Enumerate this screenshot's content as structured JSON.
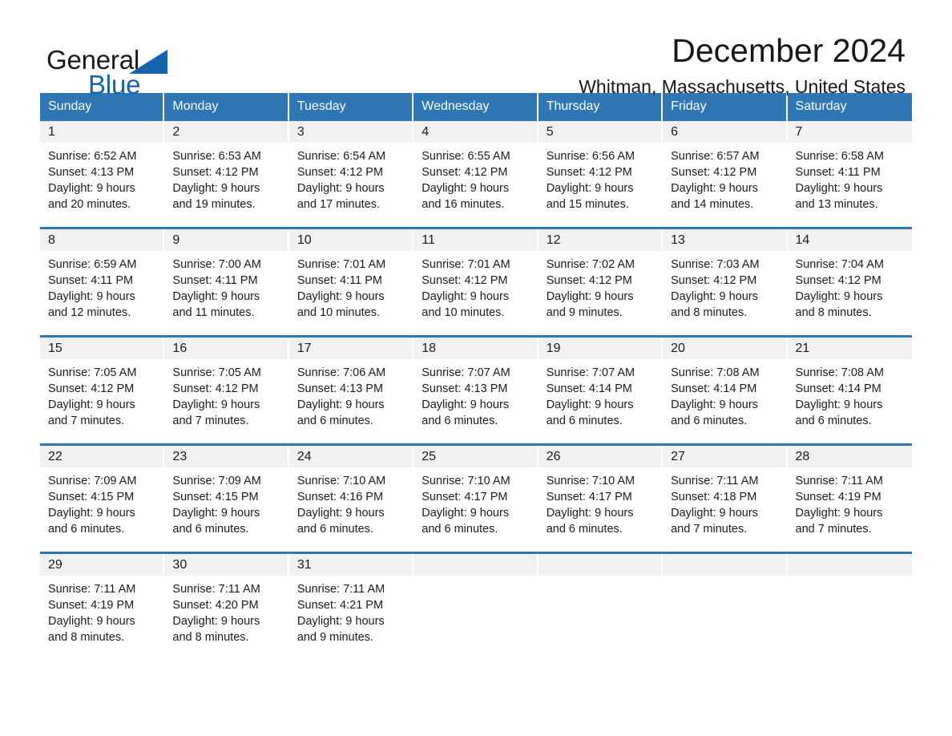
{
  "brand": {
    "name_part1": "General",
    "name_part2": "Blue",
    "triangle_icon": "triangle-icon",
    "colors": {
      "blue": "#1464ad",
      "black": "#1a1a1a"
    }
  },
  "header": {
    "title": "December 2024",
    "subtitle": "Whitman, Massachusetts, United States",
    "header_bg": "#2f76b5",
    "daynum_bg": "#f1f1f1"
  },
  "weekday_headers": [
    "Sunday",
    "Monday",
    "Tuesday",
    "Wednesday",
    "Thursday",
    "Friday",
    "Saturday"
  ],
  "weeks": [
    [
      {
        "day": "1",
        "sunrise": "Sunrise: 6:52 AM",
        "sunset": "Sunset: 4:13 PM",
        "daylight1": "Daylight: 9 hours",
        "daylight2": "and 20 minutes."
      },
      {
        "day": "2",
        "sunrise": "Sunrise: 6:53 AM",
        "sunset": "Sunset: 4:12 PM",
        "daylight1": "Daylight: 9 hours",
        "daylight2": "and 19 minutes."
      },
      {
        "day": "3",
        "sunrise": "Sunrise: 6:54 AM",
        "sunset": "Sunset: 4:12 PM",
        "daylight1": "Daylight: 9 hours",
        "daylight2": "and 17 minutes."
      },
      {
        "day": "4",
        "sunrise": "Sunrise: 6:55 AM",
        "sunset": "Sunset: 4:12 PM",
        "daylight1": "Daylight: 9 hours",
        "daylight2": "and 16 minutes."
      },
      {
        "day": "5",
        "sunrise": "Sunrise: 6:56 AM",
        "sunset": "Sunset: 4:12 PM",
        "daylight1": "Daylight: 9 hours",
        "daylight2": "and 15 minutes."
      },
      {
        "day": "6",
        "sunrise": "Sunrise: 6:57 AM",
        "sunset": "Sunset: 4:12 PM",
        "daylight1": "Daylight: 9 hours",
        "daylight2": "and 14 minutes."
      },
      {
        "day": "7",
        "sunrise": "Sunrise: 6:58 AM",
        "sunset": "Sunset: 4:11 PM",
        "daylight1": "Daylight: 9 hours",
        "daylight2": "and 13 minutes."
      }
    ],
    [
      {
        "day": "8",
        "sunrise": "Sunrise: 6:59 AM",
        "sunset": "Sunset: 4:11 PM",
        "daylight1": "Daylight: 9 hours",
        "daylight2": "and 12 minutes."
      },
      {
        "day": "9",
        "sunrise": "Sunrise: 7:00 AM",
        "sunset": "Sunset: 4:11 PM",
        "daylight1": "Daylight: 9 hours",
        "daylight2": "and 11 minutes."
      },
      {
        "day": "10",
        "sunrise": "Sunrise: 7:01 AM",
        "sunset": "Sunset: 4:11 PM",
        "daylight1": "Daylight: 9 hours",
        "daylight2": "and 10 minutes."
      },
      {
        "day": "11",
        "sunrise": "Sunrise: 7:01 AM",
        "sunset": "Sunset: 4:12 PM",
        "daylight1": "Daylight: 9 hours",
        "daylight2": "and 10 minutes."
      },
      {
        "day": "12",
        "sunrise": "Sunrise: 7:02 AM",
        "sunset": "Sunset: 4:12 PM",
        "daylight1": "Daylight: 9 hours",
        "daylight2": "and 9 minutes."
      },
      {
        "day": "13",
        "sunrise": "Sunrise: 7:03 AM",
        "sunset": "Sunset: 4:12 PM",
        "daylight1": "Daylight: 9 hours",
        "daylight2": "and 8 minutes."
      },
      {
        "day": "14",
        "sunrise": "Sunrise: 7:04 AM",
        "sunset": "Sunset: 4:12 PM",
        "daylight1": "Daylight: 9 hours",
        "daylight2": "and 8 minutes."
      }
    ],
    [
      {
        "day": "15",
        "sunrise": "Sunrise: 7:05 AM",
        "sunset": "Sunset: 4:12 PM",
        "daylight1": "Daylight: 9 hours",
        "daylight2": "and 7 minutes."
      },
      {
        "day": "16",
        "sunrise": "Sunrise: 7:05 AM",
        "sunset": "Sunset: 4:12 PM",
        "daylight1": "Daylight: 9 hours",
        "daylight2": "and 7 minutes."
      },
      {
        "day": "17",
        "sunrise": "Sunrise: 7:06 AM",
        "sunset": "Sunset: 4:13 PM",
        "daylight1": "Daylight: 9 hours",
        "daylight2": "and 6 minutes."
      },
      {
        "day": "18",
        "sunrise": "Sunrise: 7:07 AM",
        "sunset": "Sunset: 4:13 PM",
        "daylight1": "Daylight: 9 hours",
        "daylight2": "and 6 minutes."
      },
      {
        "day": "19",
        "sunrise": "Sunrise: 7:07 AM",
        "sunset": "Sunset: 4:14 PM",
        "daylight1": "Daylight: 9 hours",
        "daylight2": "and 6 minutes."
      },
      {
        "day": "20",
        "sunrise": "Sunrise: 7:08 AM",
        "sunset": "Sunset: 4:14 PM",
        "daylight1": "Daylight: 9 hours",
        "daylight2": "and 6 minutes."
      },
      {
        "day": "21",
        "sunrise": "Sunrise: 7:08 AM",
        "sunset": "Sunset: 4:14 PM",
        "daylight1": "Daylight: 9 hours",
        "daylight2": "and 6 minutes."
      }
    ],
    [
      {
        "day": "22",
        "sunrise": "Sunrise: 7:09 AM",
        "sunset": "Sunset: 4:15 PM",
        "daylight1": "Daylight: 9 hours",
        "daylight2": "and 6 minutes."
      },
      {
        "day": "23",
        "sunrise": "Sunrise: 7:09 AM",
        "sunset": "Sunset: 4:15 PM",
        "daylight1": "Daylight: 9 hours",
        "daylight2": "and 6 minutes."
      },
      {
        "day": "24",
        "sunrise": "Sunrise: 7:10 AM",
        "sunset": "Sunset: 4:16 PM",
        "daylight1": "Daylight: 9 hours",
        "daylight2": "and 6 minutes."
      },
      {
        "day": "25",
        "sunrise": "Sunrise: 7:10 AM",
        "sunset": "Sunset: 4:17 PM",
        "daylight1": "Daylight: 9 hours",
        "daylight2": "and 6 minutes."
      },
      {
        "day": "26",
        "sunrise": "Sunrise: 7:10 AM",
        "sunset": "Sunset: 4:17 PM",
        "daylight1": "Daylight: 9 hours",
        "daylight2": "and 6 minutes."
      },
      {
        "day": "27",
        "sunrise": "Sunrise: 7:11 AM",
        "sunset": "Sunset: 4:18 PM",
        "daylight1": "Daylight: 9 hours",
        "daylight2": "and 7 minutes."
      },
      {
        "day": "28",
        "sunrise": "Sunrise: 7:11 AM",
        "sunset": "Sunset: 4:19 PM",
        "daylight1": "Daylight: 9 hours",
        "daylight2": "and 7 minutes."
      }
    ],
    [
      {
        "day": "29",
        "sunrise": "Sunrise: 7:11 AM",
        "sunset": "Sunset: 4:19 PM",
        "daylight1": "Daylight: 9 hours",
        "daylight2": "and 8 minutes."
      },
      {
        "day": "30",
        "sunrise": "Sunrise: 7:11 AM",
        "sunset": "Sunset: 4:20 PM",
        "daylight1": "Daylight: 9 hours",
        "daylight2": "and 8 minutes."
      },
      {
        "day": "31",
        "sunrise": "Sunrise: 7:11 AM",
        "sunset": "Sunset: 4:21 PM",
        "daylight1": "Daylight: 9 hours",
        "daylight2": "and 9 minutes."
      },
      {
        "day": "",
        "sunrise": "",
        "sunset": "",
        "daylight1": "",
        "daylight2": ""
      },
      {
        "day": "",
        "sunrise": "",
        "sunset": "",
        "daylight1": "",
        "daylight2": ""
      },
      {
        "day": "",
        "sunrise": "",
        "sunset": "",
        "daylight1": "",
        "daylight2": ""
      },
      {
        "day": "",
        "sunrise": "",
        "sunset": "",
        "daylight1": "",
        "daylight2": ""
      }
    ]
  ]
}
